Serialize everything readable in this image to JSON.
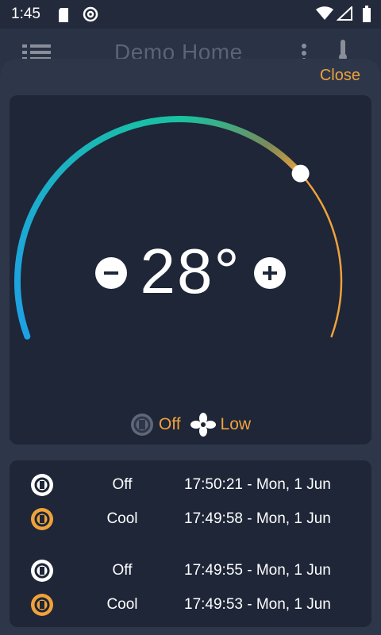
{
  "status_bar": {
    "time": "1:45",
    "icons": [
      "sd-card-icon",
      "at-icon",
      "wifi-icon",
      "cellular-icon",
      "battery-icon"
    ]
  },
  "app_bar": {
    "title": "Demo Home",
    "icons": [
      "menu-icon",
      "more-vert-icon",
      "thermometer-icon"
    ]
  },
  "sheet": {
    "close_label": "Close"
  },
  "thermostat": {
    "temperature": "28°",
    "decrease_icon": "minus-icon",
    "increase_icon": "plus-icon",
    "setpoint_fraction": 0.72,
    "hvac_mode": "Off",
    "fan_mode": "Low",
    "hvac_icon": "hvac-icon",
    "fan_icon": "fan-icon"
  },
  "history": [
    {
      "state": "Off",
      "time": "17:50:21 - Mon, 1 Jun",
      "icon": "hvac-off-icon",
      "color": "#ffffff"
    },
    {
      "state": "Cool",
      "time": "17:49:58 - Mon, 1 Jun",
      "icon": "hvac-cool-icon",
      "color": "#f0a23a"
    },
    {
      "state": "Off",
      "time": "17:49:55 - Mon, 1 Jun",
      "icon": "hvac-off-icon",
      "color": "#ffffff"
    },
    {
      "state": "Cool",
      "time": "17:49:53 - Mon, 1 Jun",
      "icon": "hvac-cool-icon",
      "color": "#f0a23a"
    }
  ],
  "colors": {
    "accent": "#f0a23a",
    "dial_start": "#1ea0e6",
    "dial_mid": "#19c2a0",
    "dial_end": "#f0a23a"
  }
}
